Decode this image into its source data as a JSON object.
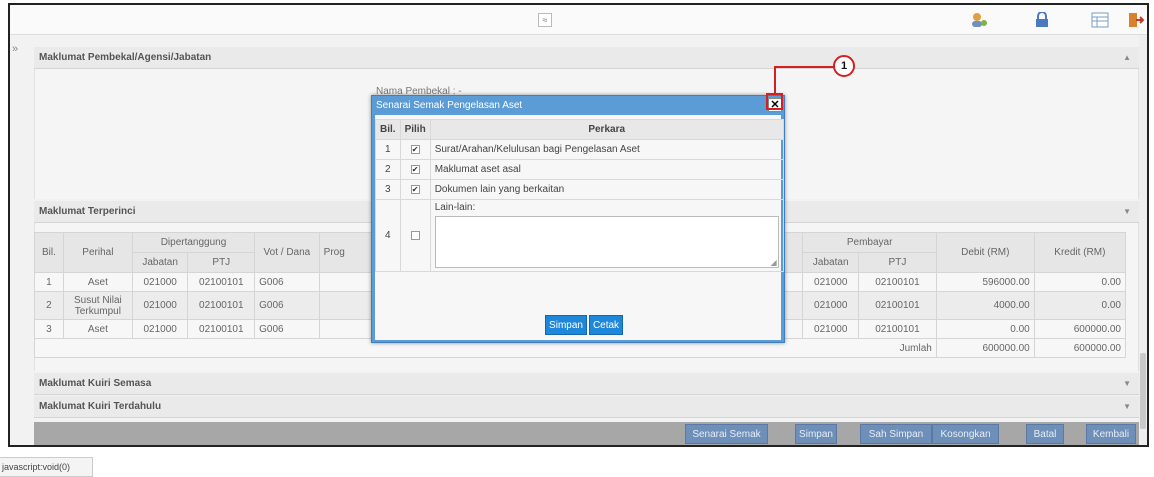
{
  "toolbar": {
    "collapse_glyph": "≈",
    "icons": [
      "user-icon",
      "lock-icon",
      "table-icon",
      "exit-icon"
    ]
  },
  "sidebar_toggle": "»",
  "sections": {
    "supplier": "Maklumat Pembekal/Agensi/Jabatan",
    "supplier_name_label": "Nama Pembekal :  -",
    "detail": "Maklumat Terperinci",
    "current_query": "Maklumat Kuiri Semasa",
    "previous_query": "Maklumat Kuiri Terdahulu"
  },
  "table": {
    "headers": {
      "bil": "Bil.",
      "perihal": "Perihal",
      "dipertanggung": "Dipertanggung",
      "jabatan": "Jabatan",
      "ptj": "PTJ",
      "vot": "Vot / Dana",
      "prog": "Prog",
      "pembayar": "Pembayar",
      "debit": "Debit (RM)",
      "kredit": "Kredit (RM)"
    },
    "rows": [
      {
        "bil": "1",
        "perihal": "Aset",
        "jabatan": "021000",
        "ptj": "02100101",
        "vot": "G006",
        "p_jabatan": "021000",
        "p_ptj": "02100101",
        "debit": "596000.00",
        "kredit": "0.00"
      },
      {
        "bil": "2",
        "perihal": "Susut Nilai Terkumpul",
        "jabatan": "021000",
        "ptj": "02100101",
        "vot": "G006",
        "p_jabatan": "021000",
        "p_ptj": "02100101",
        "debit": "4000.00",
        "kredit": "0.00"
      },
      {
        "bil": "3",
        "perihal": "Aset",
        "jabatan": "021000",
        "ptj": "02100101",
        "vot": "G006",
        "p_jabatan": "021000",
        "p_ptj": "02100101",
        "debit": "0.00",
        "kredit": "600000.00"
      }
    ],
    "total_label": "Jumlah",
    "total_debit": "600000.00",
    "total_kredit": "600000.00"
  },
  "buttons": [
    "Senarai Semak",
    "Simpan",
    "Sah Simpan",
    "Kosongkan",
    "Batal",
    "Kembali"
  ],
  "status_text": "javascript:void(0)",
  "dialog": {
    "title": "Senarai Semak Pengelasan Aset",
    "close_glyph": "✕",
    "headers": {
      "bil": "Bil.",
      "pilih": "Pilih",
      "perkara": "Perkara"
    },
    "items": [
      {
        "bil": "1",
        "checked": "✔",
        "text": "Surat/Arahan/Kelulusan bagi Pengelasan Aset"
      },
      {
        "bil": "2",
        "checked": "✔",
        "text": "Maklumat aset asal"
      },
      {
        "bil": "3",
        "checked": "✔",
        "text": "Dokumen lain yang berkaitan"
      }
    ],
    "other": {
      "bil": "4",
      "label": "Lain-lain:",
      "value": ""
    },
    "save_label": "Simpan",
    "print_label": "Cetak"
  },
  "callout_number": "1",
  "colors": {
    "accent": "#5b9bd6",
    "button": "#1f87d9",
    "callout": "#d42020"
  }
}
